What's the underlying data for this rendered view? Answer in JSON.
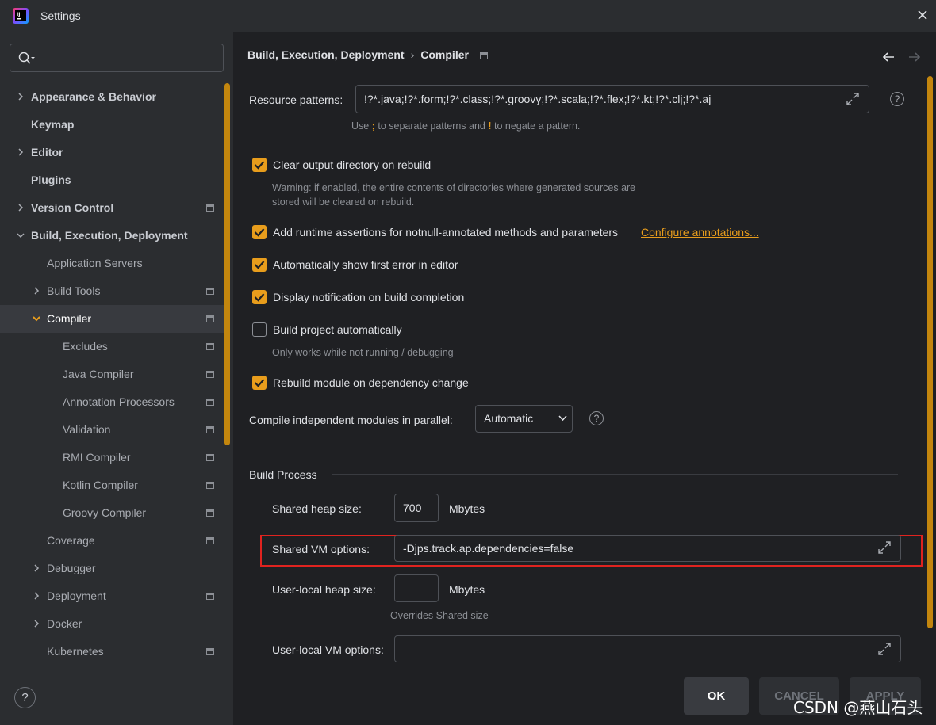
{
  "window": {
    "title": "Settings"
  },
  "sidebar": {
    "items": [
      {
        "label": "Appearance & Behavior",
        "level": 0,
        "bold": true,
        "chevron": "right",
        "page_icon": false
      },
      {
        "label": "Keymap",
        "level": 0,
        "bold": true,
        "chevron": "none",
        "page_icon": false
      },
      {
        "label": "Editor",
        "level": 0,
        "bold": true,
        "chevron": "right",
        "page_icon": false
      },
      {
        "label": "Plugins",
        "level": 0,
        "bold": true,
        "chevron": "none",
        "page_icon": false
      },
      {
        "label": "Version Control",
        "level": 0,
        "bold": true,
        "chevron": "right",
        "page_icon": true
      },
      {
        "label": "Build, Execution, Deployment",
        "level": 0,
        "bold": true,
        "chevron": "down",
        "page_icon": false
      },
      {
        "label": "Application Servers",
        "level": 1,
        "bold": false,
        "chevron": "none",
        "page_icon": false
      },
      {
        "label": "Build Tools",
        "level": 1,
        "bold": false,
        "chevron": "right",
        "page_icon": true
      },
      {
        "label": "Compiler",
        "level": 1,
        "bold": false,
        "chevron": "down",
        "page_icon": true,
        "selected": true
      },
      {
        "label": "Excludes",
        "level": 2,
        "bold": false,
        "chevron": "none",
        "page_icon": true
      },
      {
        "label": "Java Compiler",
        "level": 2,
        "bold": false,
        "chevron": "none",
        "page_icon": true
      },
      {
        "label": "Annotation Processors",
        "level": 2,
        "bold": false,
        "chevron": "none",
        "page_icon": true
      },
      {
        "label": "Validation",
        "level": 2,
        "bold": false,
        "chevron": "none",
        "page_icon": true
      },
      {
        "label": "RMI Compiler",
        "level": 2,
        "bold": false,
        "chevron": "none",
        "page_icon": true
      },
      {
        "label": "Kotlin Compiler",
        "level": 2,
        "bold": false,
        "chevron": "none",
        "page_icon": true
      },
      {
        "label": "Groovy Compiler",
        "level": 2,
        "bold": false,
        "chevron": "none",
        "page_icon": true
      },
      {
        "label": "Coverage",
        "level": 1,
        "bold": false,
        "chevron": "none",
        "page_icon": true
      },
      {
        "label": "Debugger",
        "level": 1,
        "bold": false,
        "chevron": "right",
        "page_icon": false
      },
      {
        "label": "Deployment",
        "level": 1,
        "bold": false,
        "chevron": "right",
        "page_icon": true
      },
      {
        "label": "Docker",
        "level": 1,
        "bold": false,
        "chevron": "right",
        "page_icon": false
      },
      {
        "label": "Kubernetes",
        "level": 1,
        "bold": false,
        "chevron": "none",
        "page_icon": true
      }
    ],
    "help_label": "?"
  },
  "breadcrumb": {
    "parent": "Build, Execution, Deployment",
    "sep": "›",
    "current": "Compiler"
  },
  "resource_patterns": {
    "label": "Resource patterns:",
    "value": "!?*.java;!?*.form;!?*.class;!?*.groovy;!?*.scala;!?*.flex;!?*.kt;!?*.clj;!?*.aj",
    "hint_pre": "Use ",
    "hint_semi": ";",
    "hint_mid": " to separate patterns and ",
    "hint_bang": "!",
    "hint_post": " to negate a pattern."
  },
  "options": {
    "clear_output": {
      "label": "Clear output directory on rebuild",
      "checked": true
    },
    "clear_warning_1": "Warning: if enabled, the entire contents of directories where generated sources are",
    "clear_warning_2": "stored will be cleared on rebuild.",
    "runtime_assertions": {
      "label": "Add runtime assertions for notnull-annotated methods and parameters",
      "checked": true
    },
    "configure_link": "Configure annotations...",
    "show_first_error": {
      "label": "Automatically show first error in editor",
      "checked": true
    },
    "display_notification": {
      "label": "Display notification on build completion",
      "checked": true
    },
    "build_automatically": {
      "label": "Build project automatically",
      "checked": false
    },
    "build_auto_hint": "Only works while not running / debugging",
    "rebuild_module": {
      "label": "Rebuild module on dependency change",
      "checked": true
    }
  },
  "parallel": {
    "label": "Compile independent modules in parallel:",
    "value": "Automatic"
  },
  "build_process": {
    "title": "Build Process",
    "shared_heap_label": "Shared heap size:",
    "shared_heap_value": "700",
    "mbytes": "Mbytes",
    "shared_vm_label": "Shared VM options:",
    "shared_vm_value": "-Djps.track.ap.dependencies=false",
    "user_heap_label": "User-local heap size:",
    "user_heap_value": "",
    "user_heap_hint": "Overrides Shared size",
    "user_vm_label": "User-local VM options:",
    "user_vm_value": ""
  },
  "buttons": {
    "ok": "OK",
    "cancel": "CANCEL",
    "apply": "APPLY"
  },
  "watermark": "CSDN @燕山石头",
  "colors": {
    "accent": "#e89d1c",
    "highlight": "#e0231f",
    "background": "#1f2023",
    "sidebar": "#2b2d30"
  }
}
